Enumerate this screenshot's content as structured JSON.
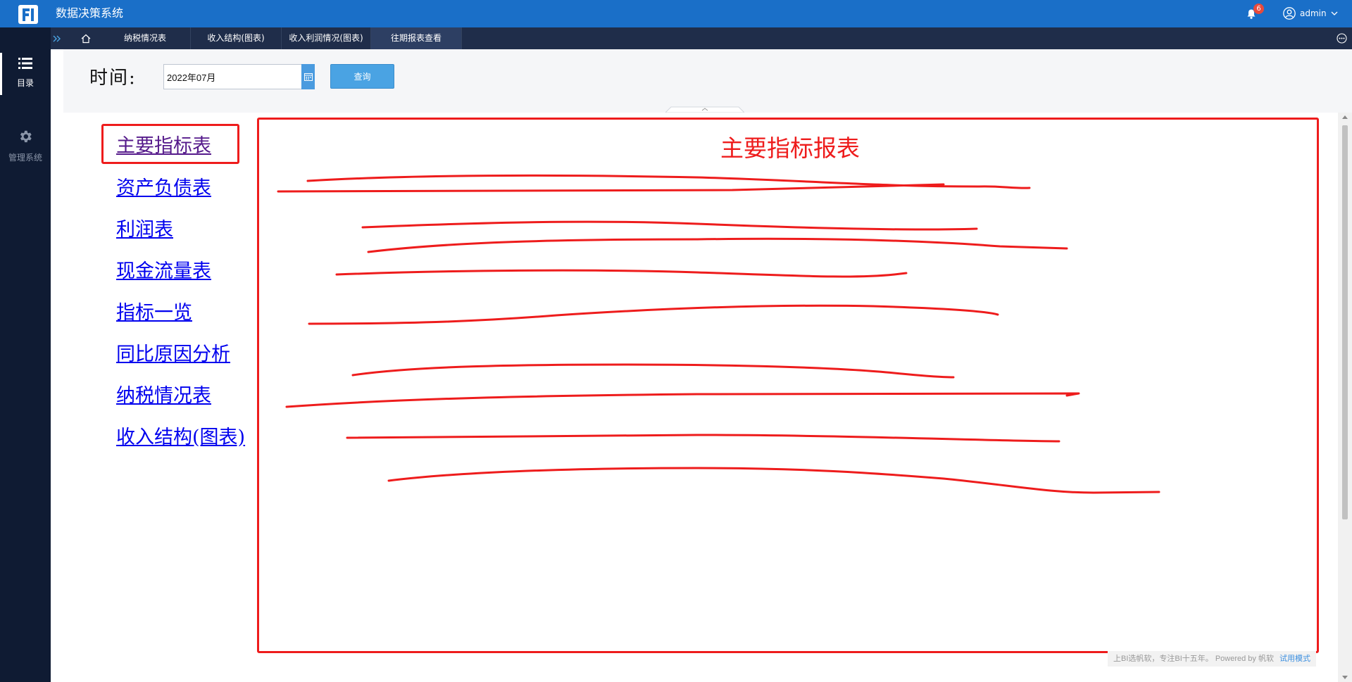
{
  "header": {
    "app_title": "数据决策系统",
    "notification_count": "6",
    "username": "admin",
    "colors": {
      "bar": "#1a6fc8",
      "badge": "#e84a3c"
    }
  },
  "left_rail": {
    "items": [
      {
        "label": "目录",
        "icon": "list-icon",
        "active": true
      },
      {
        "label": "管理系统",
        "icon": "gear-icon",
        "active": false
      }
    ]
  },
  "tabs": [
    {
      "label": "纳税情况表"
    },
    {
      "label": "收入结构(图表)"
    },
    {
      "label": "收入利润情况(图表)"
    },
    {
      "label": "往期报表查看",
      "active": true
    }
  ],
  "filter": {
    "time_label": "时间:",
    "date_value": "2022年07月",
    "query_label": "查询"
  },
  "report": {
    "nav_links": [
      {
        "label": "主要指标表",
        "visited": true
      },
      {
        "label": "资产负债表"
      },
      {
        "label": "利润表"
      },
      {
        "label": "现金流量表"
      },
      {
        "label": "指标一览"
      },
      {
        "label": "同比原因分析"
      },
      {
        "label": "纳税情况表"
      },
      {
        "label": "收入结构(图表)"
      }
    ],
    "title": "主要指标报表",
    "annotation_color": "#ee1c1c"
  },
  "footer": {
    "text": "上BI选帆软，专注BI十五年。 Powered by 帆软",
    "trial_label": "试用模式"
  }
}
